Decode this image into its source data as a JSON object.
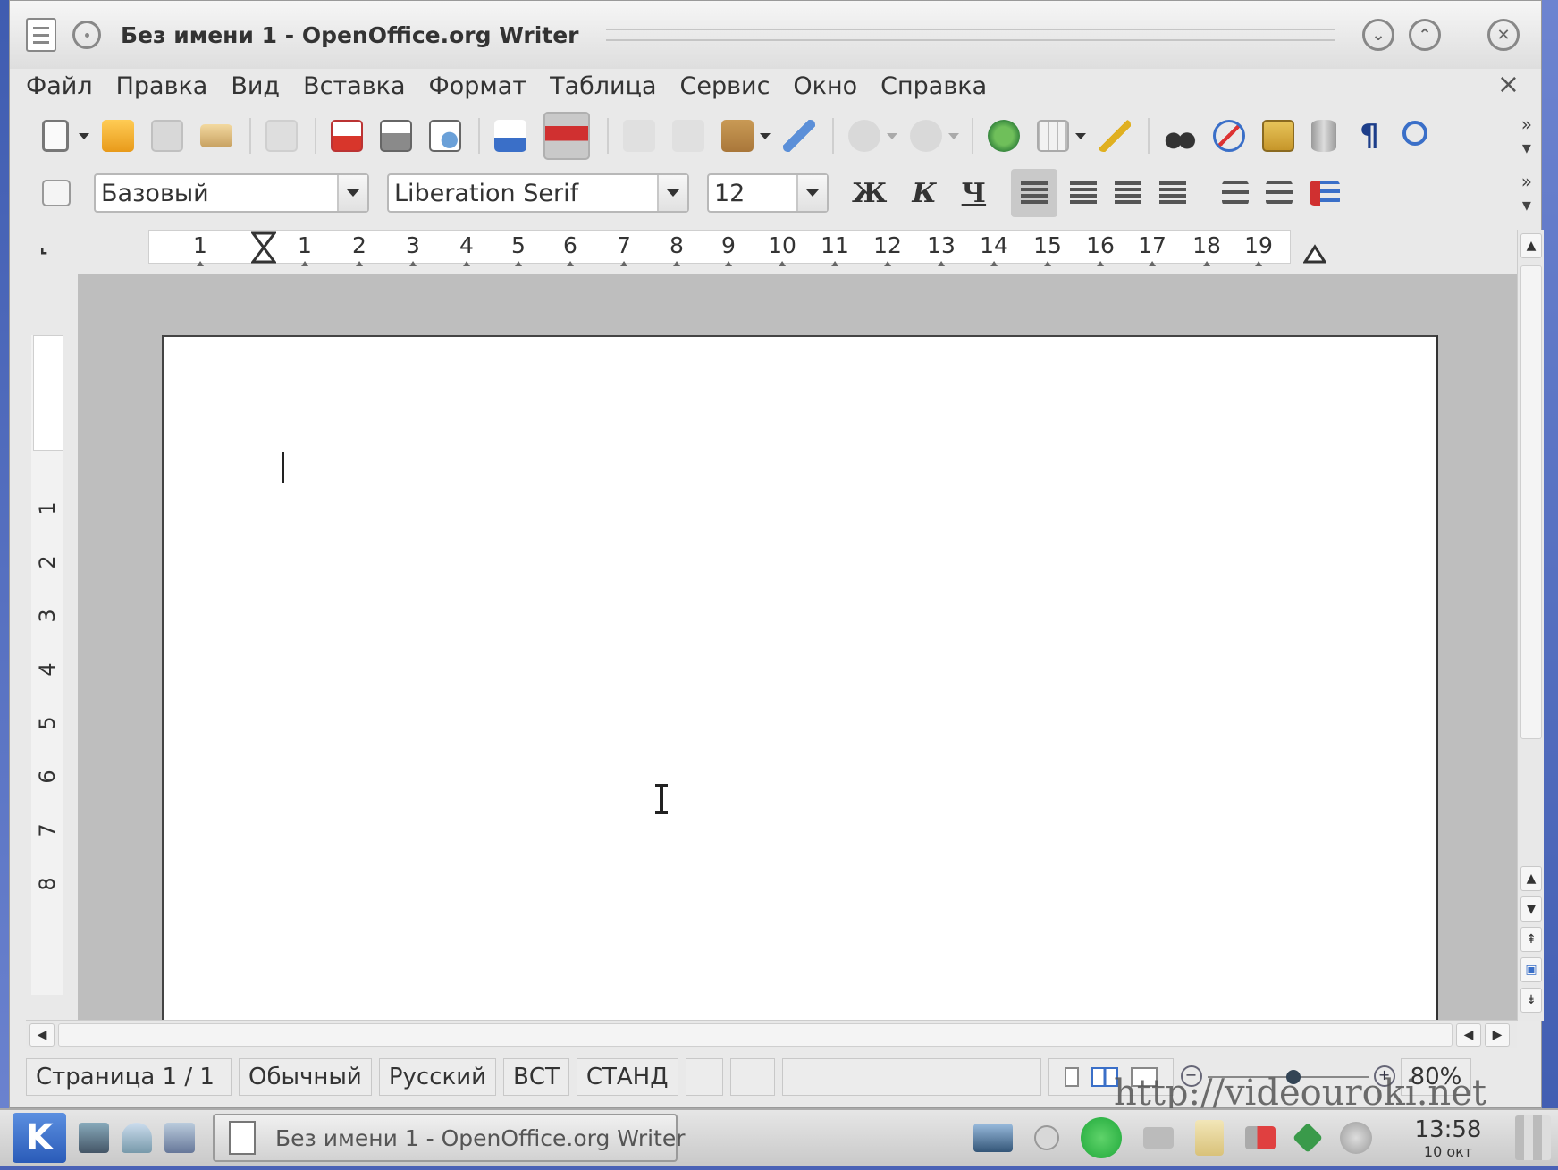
{
  "window": {
    "title": "Без имени 1 - OpenOffice.org Writer"
  },
  "menubar": {
    "items": [
      "Файл",
      "Правка",
      "Вид",
      "Вставка",
      "Формат",
      "Таблица",
      "Сервис",
      "Окно",
      "Справка"
    ],
    "close_glyph": "×"
  },
  "standard_toolbar": {
    "icons": [
      "new-document-icon",
      "open-folder-icon",
      "save-icon",
      "email-icon",
      "edit-file-icon",
      "export-pdf-icon",
      "print-icon",
      "print-preview-icon",
      "spellcheck-icon",
      "autospellcheck-icon",
      "cut-icon",
      "copy-icon",
      "paste-icon",
      "format-paintbrush-icon",
      "undo-icon",
      "redo-icon",
      "hyperlink-icon",
      "table-icon",
      "show-draw-functions-icon",
      "find-replace-icon",
      "navigator-icon",
      "gallery-icon",
      "data-sources-icon",
      "nonprinting-chars-icon",
      "zoom-icon"
    ],
    "more_glyph": "»"
  },
  "format_toolbar": {
    "paragraph_style": "Базовый",
    "font_name": "Liberation Serif",
    "font_size": "12",
    "bold_label": "Ж",
    "italic_label": "К",
    "underline_label": "Ч",
    "more_glyph": "»"
  },
  "ruler": {
    "corner_glyph": "⌞",
    "h_ticks": [
      "1",
      "1",
      "2",
      "3",
      "4",
      "5",
      "6",
      "7",
      "8",
      "9",
      "10",
      "11",
      "12",
      "13",
      "14",
      "15",
      "16",
      "17",
      "18",
      "19"
    ],
    "v_ticks": [
      "1",
      "1",
      "2",
      "3",
      "4",
      "5",
      "6",
      "7",
      "8"
    ]
  },
  "statusbar": {
    "page": "Страница  1 / 1",
    "page_style": "Обычный",
    "language": "Русский",
    "insert_mode": "ВСТ",
    "selection_mode": "СТАНД",
    "zoom": "80%"
  },
  "watermark": "http://videouroki.net",
  "taskbar": {
    "k_menu_label": "K",
    "task_title": "Без имени 1 - OpenOffice.org Writer",
    "clock_time": "13:58",
    "clock_date": "10 окт"
  },
  "colors": {
    "accent_blue": "#2a5bb8",
    "tray_green": "#1fa83a"
  }
}
